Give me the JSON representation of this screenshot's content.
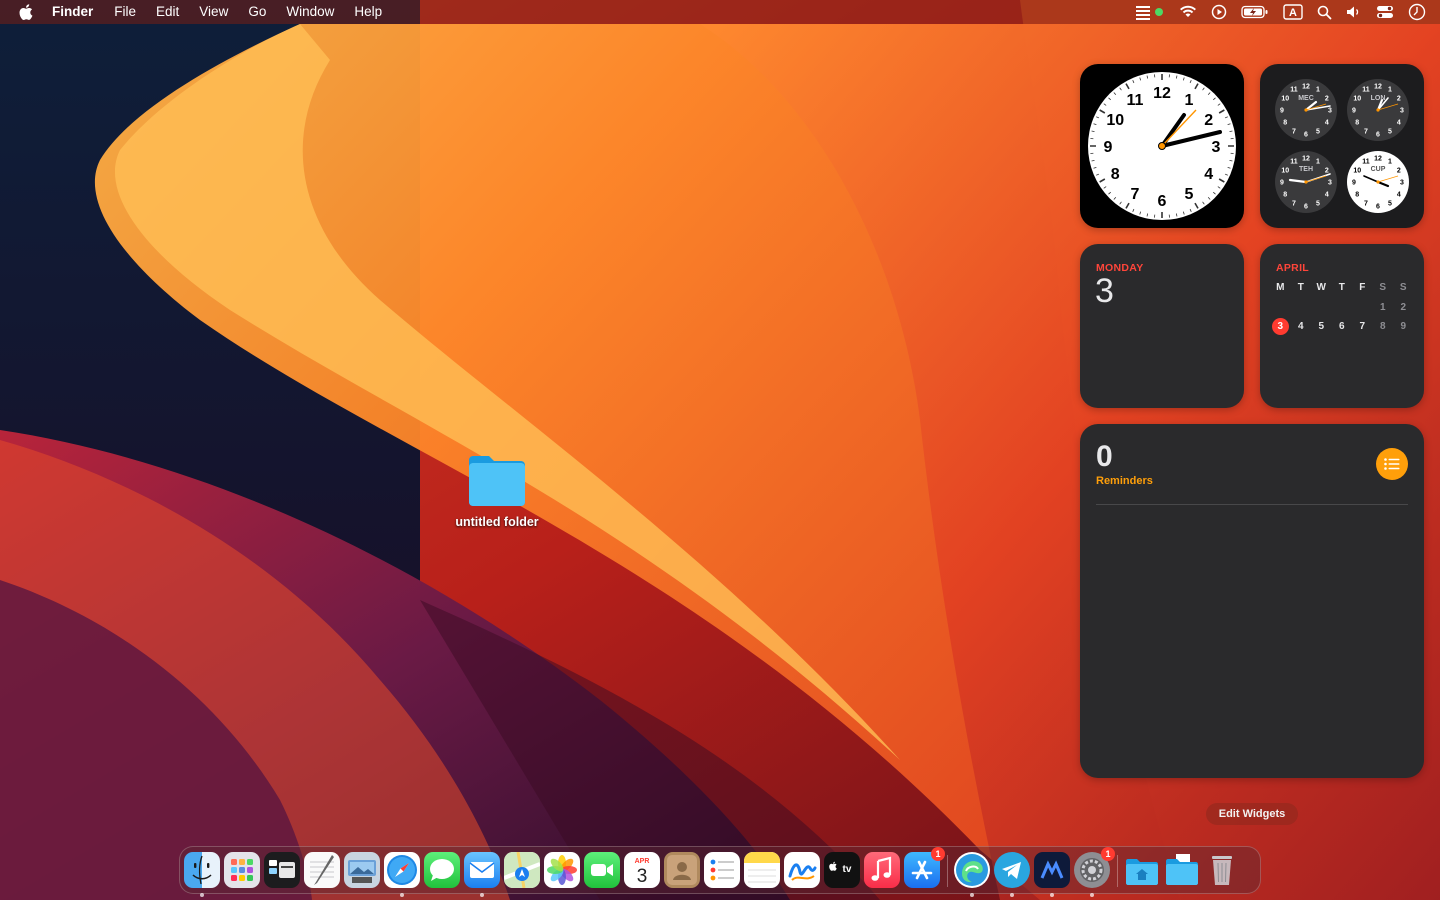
{
  "menubar": {
    "app_name": "Finder",
    "menus": [
      "File",
      "Edit",
      "View",
      "Go",
      "Window",
      "Help"
    ],
    "status_icons": [
      "stage-manager-icon",
      "wifi-icon",
      "play-icon",
      "battery-charging-icon",
      "input-source-icon",
      "spotlight-icon",
      "volume-icon",
      "control-center-icon",
      "clock-icon"
    ],
    "input_source_label": "A"
  },
  "desktop": {
    "folder_label": "untitled folder"
  },
  "widgets": {
    "clock": {
      "numbers": [
        "12",
        "1",
        "2",
        "3",
        "4",
        "5",
        "6",
        "7",
        "8",
        "9",
        "10",
        "11"
      ]
    },
    "world_clock": {
      "cities": [
        "MEC",
        "LON",
        "TEH",
        "CUP"
      ]
    },
    "date": {
      "weekday": "MONDAY",
      "day": "3"
    },
    "calendar": {
      "month": "APRIL",
      "weekdays": [
        "M",
        "T",
        "W",
        "T",
        "F",
        "S",
        "S"
      ],
      "rows": [
        [
          "",
          "",
          "",
          "",
          "",
          "1",
          "2"
        ],
        [
          "3",
          "4",
          "5",
          "6",
          "7",
          "8",
          "9"
        ]
      ],
      "today": "3"
    },
    "reminders": {
      "count": "0",
      "label": "Reminders"
    },
    "edit_label": "Edit Widgets"
  },
  "dock": {
    "apps": [
      {
        "name": "finder-icon",
        "running": true
      },
      {
        "name": "launchpad-icon",
        "running": false
      },
      {
        "name": "stage-manager-app-icon",
        "running": false
      },
      {
        "name": "textedit-icon",
        "running": false
      },
      {
        "name": "preview-icon",
        "running": false
      },
      {
        "name": "safari-icon",
        "running": true
      },
      {
        "name": "messages-icon",
        "running": false
      },
      {
        "name": "mail-icon",
        "running": true
      },
      {
        "name": "maps-icon",
        "running": false
      },
      {
        "name": "photos-icon",
        "running": false
      },
      {
        "name": "facetime-icon",
        "running": false
      },
      {
        "name": "calendar-icon",
        "running": false
      },
      {
        "name": "contacts-icon",
        "running": false
      },
      {
        "name": "reminders-icon",
        "running": false
      },
      {
        "name": "notes-icon",
        "running": false
      },
      {
        "name": "freeform-icon",
        "running": false
      },
      {
        "name": "apple-tv-icon",
        "running": false
      },
      {
        "name": "music-icon",
        "running": false
      },
      {
        "name": "app-store-icon",
        "running": false,
        "badge": "1"
      },
      {
        "name": "edge-icon",
        "running": true
      },
      {
        "name": "telegram-icon",
        "running": true
      },
      {
        "name": "nord-icon",
        "running": true
      },
      {
        "name": "system-settings-icon",
        "running": true,
        "badge": "1"
      },
      {
        "name": "downloads-folder-icon",
        "running": false
      },
      {
        "name": "documents-folder-icon",
        "running": false
      },
      {
        "name": "trash-icon",
        "running": false
      }
    ],
    "calendar_icon_month": "APR",
    "calendar_icon_day": "3",
    "tv_label": "tv"
  },
  "colors": {
    "accent_red": "#ff453a",
    "accent_orange": "#ff9f0a",
    "widget_bg": "#2a2a2c"
  }
}
